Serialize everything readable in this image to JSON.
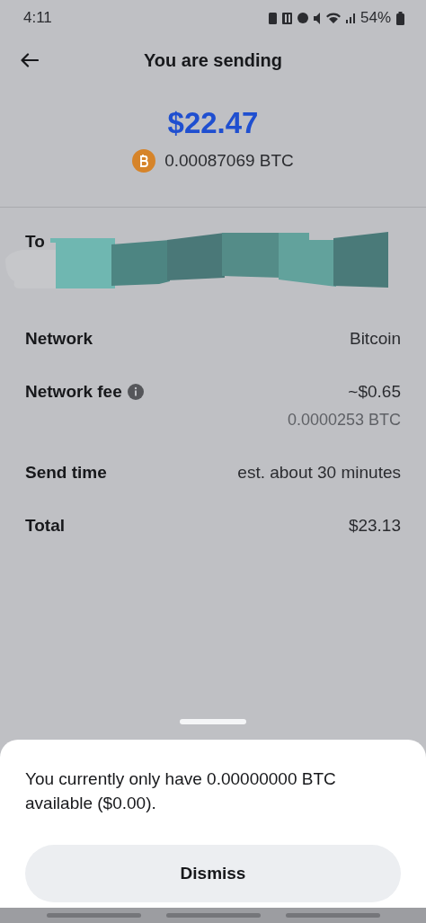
{
  "status_bar": {
    "time": "4:11",
    "battery": "54%"
  },
  "header": {
    "title": "You are sending"
  },
  "amount": {
    "fiat": "$22.47",
    "crypto": "0.00087069 BTC"
  },
  "recipient": {
    "label": "To"
  },
  "details": [
    {
      "label": "Network",
      "value": "Bitcoin",
      "info": false
    },
    {
      "label": "Network fee",
      "value": "~$0.65",
      "subvalue": "0.0000253 BTC",
      "info": true
    },
    {
      "label": "Send time",
      "value": "est. about 30 minutes",
      "info": false
    },
    {
      "label": "Total",
      "value": "$23.13",
      "info": false
    }
  ],
  "sheet": {
    "message": "You currently only have 0.00000000 BTC available ($0.00).",
    "button": "Dismiss"
  }
}
